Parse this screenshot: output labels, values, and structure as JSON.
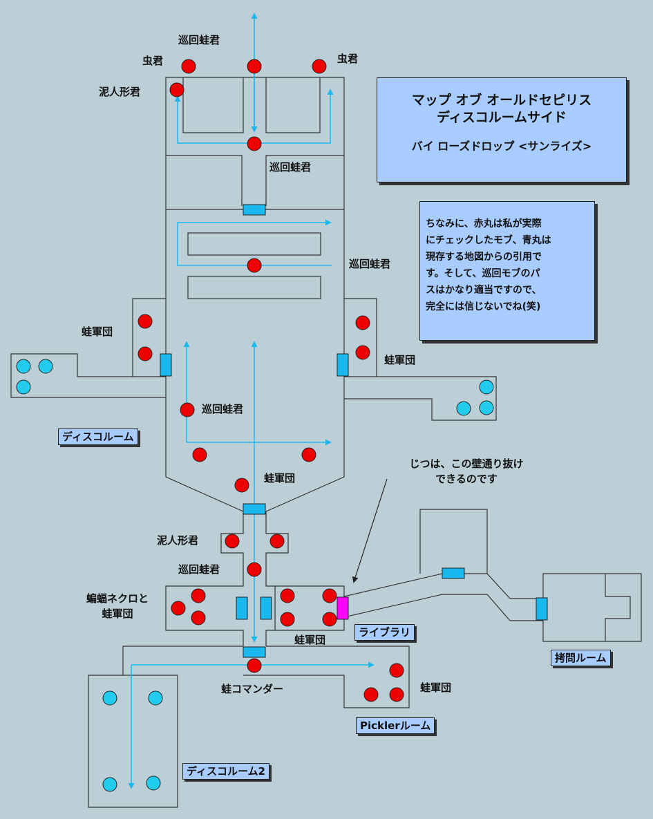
{
  "title": {
    "line1": "マップ オブ オールドセピリス",
    "line2": "ディスコルームサイド",
    "line3": "バイ ローズドロップ <サンライズ>"
  },
  "note": [
    "ちなみに、赤丸は私が実際",
    "にチェックしたモブ、青丸は",
    "現存する地図からの引用で",
    "す。そして、巡回モブのパ",
    "スはかなり適当ですので、",
    "完全には信じないでね(笑)"
  ],
  "wall_note": [
    "じつは、この壁通り抜け",
    "できるのです"
  ],
  "labels": {
    "junkai_top": "巡回蛙君",
    "mushi_left": "虫君",
    "mushi_right": "虫君",
    "doro_top": "泥人形君",
    "junkai_2": "巡回蛙君",
    "junkai_3": "巡回蛙君",
    "kaeru_left": "蛙軍団",
    "kaeru_right": "蛙軍団",
    "junkai_4": "巡回蛙君",
    "kaeru_mid": "蛙軍団",
    "doro_mid": "泥人形君",
    "junkai_5": "巡回蛙君",
    "koumori_1": "蝙蝠ネクロと",
    "koumori_2": "蛙軍団",
    "kaeru_low": "蛙軍団",
    "commander": "蛙コマンダー",
    "kaeru_pickler": "蛙軍団"
  },
  "rooms": {
    "disco": "ディスコルーム",
    "library": "ライブラリ",
    "torture": "拷問ルーム",
    "pickler": "Picklerルーム",
    "disco2": "ディスコルーム2"
  },
  "colors": {
    "background": "#bccfd6",
    "wall": "#333333",
    "path": "#19b8ee",
    "observed_mob": "#ee0000",
    "mapped_mob": "#22ccee",
    "door": "#19b8ee",
    "passable_wall": "#ff00ff",
    "label_box": "#a9ccff"
  }
}
